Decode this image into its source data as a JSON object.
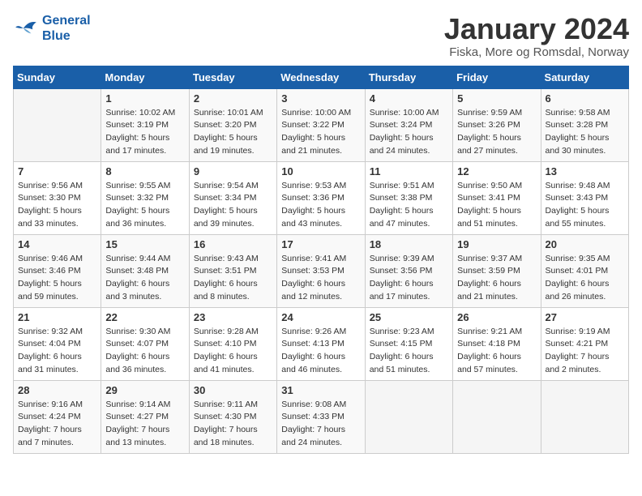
{
  "header": {
    "logo_line1": "General",
    "logo_line2": "Blue",
    "title": "January 2024",
    "subtitle": "Fiska, More og Romsdal, Norway"
  },
  "weekdays": [
    "Sunday",
    "Monday",
    "Tuesday",
    "Wednesday",
    "Thursday",
    "Friday",
    "Saturday"
  ],
  "weeks": [
    [
      {
        "day": "",
        "info": ""
      },
      {
        "day": "1",
        "info": "Sunrise: 10:02 AM\nSunset: 3:19 PM\nDaylight: 5 hours\nand 17 minutes."
      },
      {
        "day": "2",
        "info": "Sunrise: 10:01 AM\nSunset: 3:20 PM\nDaylight: 5 hours\nand 19 minutes."
      },
      {
        "day": "3",
        "info": "Sunrise: 10:00 AM\nSunset: 3:22 PM\nDaylight: 5 hours\nand 21 minutes."
      },
      {
        "day": "4",
        "info": "Sunrise: 10:00 AM\nSunset: 3:24 PM\nDaylight: 5 hours\nand 24 minutes."
      },
      {
        "day": "5",
        "info": "Sunrise: 9:59 AM\nSunset: 3:26 PM\nDaylight: 5 hours\nand 27 minutes."
      },
      {
        "day": "6",
        "info": "Sunrise: 9:58 AM\nSunset: 3:28 PM\nDaylight: 5 hours\nand 30 minutes."
      }
    ],
    [
      {
        "day": "7",
        "info": "Sunrise: 9:56 AM\nSunset: 3:30 PM\nDaylight: 5 hours\nand 33 minutes."
      },
      {
        "day": "8",
        "info": "Sunrise: 9:55 AM\nSunset: 3:32 PM\nDaylight: 5 hours\nand 36 minutes."
      },
      {
        "day": "9",
        "info": "Sunrise: 9:54 AM\nSunset: 3:34 PM\nDaylight: 5 hours\nand 39 minutes."
      },
      {
        "day": "10",
        "info": "Sunrise: 9:53 AM\nSunset: 3:36 PM\nDaylight: 5 hours\nand 43 minutes."
      },
      {
        "day": "11",
        "info": "Sunrise: 9:51 AM\nSunset: 3:38 PM\nDaylight: 5 hours\nand 47 minutes."
      },
      {
        "day": "12",
        "info": "Sunrise: 9:50 AM\nSunset: 3:41 PM\nDaylight: 5 hours\nand 51 minutes."
      },
      {
        "day": "13",
        "info": "Sunrise: 9:48 AM\nSunset: 3:43 PM\nDaylight: 5 hours\nand 55 minutes."
      }
    ],
    [
      {
        "day": "14",
        "info": "Sunrise: 9:46 AM\nSunset: 3:46 PM\nDaylight: 5 hours\nand 59 minutes."
      },
      {
        "day": "15",
        "info": "Sunrise: 9:44 AM\nSunset: 3:48 PM\nDaylight: 6 hours\nand 3 minutes."
      },
      {
        "day": "16",
        "info": "Sunrise: 9:43 AM\nSunset: 3:51 PM\nDaylight: 6 hours\nand 8 minutes."
      },
      {
        "day": "17",
        "info": "Sunrise: 9:41 AM\nSunset: 3:53 PM\nDaylight: 6 hours\nand 12 minutes."
      },
      {
        "day": "18",
        "info": "Sunrise: 9:39 AM\nSunset: 3:56 PM\nDaylight: 6 hours\nand 17 minutes."
      },
      {
        "day": "19",
        "info": "Sunrise: 9:37 AM\nSunset: 3:59 PM\nDaylight: 6 hours\nand 21 minutes."
      },
      {
        "day": "20",
        "info": "Sunrise: 9:35 AM\nSunset: 4:01 PM\nDaylight: 6 hours\nand 26 minutes."
      }
    ],
    [
      {
        "day": "21",
        "info": "Sunrise: 9:32 AM\nSunset: 4:04 PM\nDaylight: 6 hours\nand 31 minutes."
      },
      {
        "day": "22",
        "info": "Sunrise: 9:30 AM\nSunset: 4:07 PM\nDaylight: 6 hours\nand 36 minutes."
      },
      {
        "day": "23",
        "info": "Sunrise: 9:28 AM\nSunset: 4:10 PM\nDaylight: 6 hours\nand 41 minutes."
      },
      {
        "day": "24",
        "info": "Sunrise: 9:26 AM\nSunset: 4:13 PM\nDaylight: 6 hours\nand 46 minutes."
      },
      {
        "day": "25",
        "info": "Sunrise: 9:23 AM\nSunset: 4:15 PM\nDaylight: 6 hours\nand 51 minutes."
      },
      {
        "day": "26",
        "info": "Sunrise: 9:21 AM\nSunset: 4:18 PM\nDaylight: 6 hours\nand 57 minutes."
      },
      {
        "day": "27",
        "info": "Sunrise: 9:19 AM\nSunset: 4:21 PM\nDaylight: 7 hours\nand 2 minutes."
      }
    ],
    [
      {
        "day": "28",
        "info": "Sunrise: 9:16 AM\nSunset: 4:24 PM\nDaylight: 7 hours\nand 7 minutes."
      },
      {
        "day": "29",
        "info": "Sunrise: 9:14 AM\nSunset: 4:27 PM\nDaylight: 7 hours\nand 13 minutes."
      },
      {
        "day": "30",
        "info": "Sunrise: 9:11 AM\nSunset: 4:30 PM\nDaylight: 7 hours\nand 18 minutes."
      },
      {
        "day": "31",
        "info": "Sunrise: 9:08 AM\nSunset: 4:33 PM\nDaylight: 7 hours\nand 24 minutes."
      },
      {
        "day": "",
        "info": ""
      },
      {
        "day": "",
        "info": ""
      },
      {
        "day": "",
        "info": ""
      }
    ]
  ]
}
